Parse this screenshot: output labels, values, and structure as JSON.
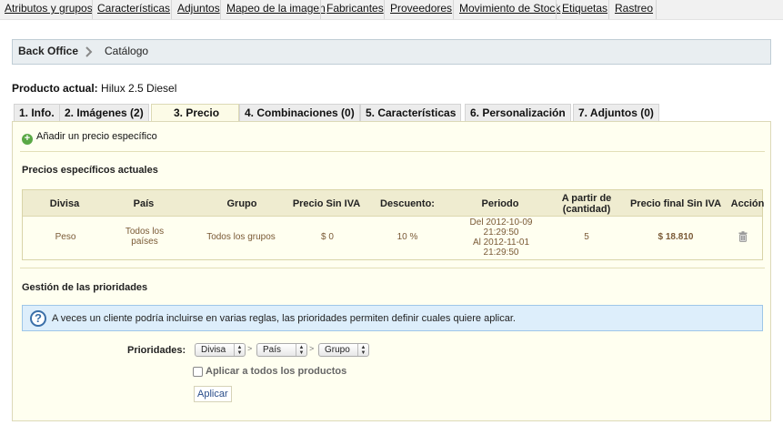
{
  "topnav": {
    "items": [
      "Atributos y grupos",
      "Características",
      "Adjuntos",
      "Mapeo de la imagen",
      "Fabricantes",
      "Proveedores",
      "Movimiento de Stock",
      "Etiquetas",
      "Rastreo"
    ]
  },
  "breadcrumb": {
    "home": "Back Office",
    "current": "Catálogo"
  },
  "product": {
    "label": "Producto actual:",
    "name": "Hilux 2.5 Diesel"
  },
  "tabs": [
    {
      "label": "1. Info."
    },
    {
      "label": "2. Imágenes (2)"
    },
    {
      "label": "3. Precio"
    },
    {
      "label": "4. Combinaciones (0)"
    },
    {
      "label": "5. Características"
    },
    {
      "label": "6. Personalización"
    },
    {
      "label": "7. Adjuntos (0)"
    }
  ],
  "active_tab": "3. Precio",
  "price": {
    "add_link": "Añadir un precio específico",
    "current_title": "Precios específicos actuales",
    "table": {
      "headers": [
        "Divisa",
        "País",
        "Grupo",
        "Precio Sin IVA",
        "Descuento:",
        "Periodo",
        "A partir de (cantidad)",
        "Precio final Sin IVA",
        "Acción"
      ],
      "header_lines": {
        "from_qty": [
          "A partir de",
          "(cantidad)"
        ]
      },
      "rows": [
        {
          "currency": "Peso",
          "country": [
            "Todos los",
            "países"
          ],
          "group": "Todos los grupos",
          "price": "$ 0",
          "discount": "10 %",
          "period": [
            "Del 2012-10-09",
            "21:29:50",
            "Al 2012-11-01",
            "21:29:50"
          ],
          "from_qty": "5",
          "final_price": "$ 18.810"
        }
      ]
    },
    "priorities_title": "Gestión de las prioridades",
    "info_text": "A veces un cliente podría incluirse en varias reglas, las prioridades permiten definir cuales quiere aplicar.",
    "priorities_label": "Prioridades:",
    "selects": [
      "Divisa",
      "País",
      "Grupo"
    ],
    "separator": ">",
    "apply_all_label": "Aplicar a todos los productos",
    "apply_button": "Aplicar"
  },
  "icons": {
    "add": "plus-circle-icon",
    "info": "question-circle-icon",
    "delete": "trash-icon",
    "breadcrumb_sep": "chevron-right-icon"
  },
  "colors": {
    "panel_bg": "#fffff0",
    "table_header_bg": "#efecd0",
    "info_bg": "#ddeefb",
    "cell_text": "#7a5a36"
  }
}
